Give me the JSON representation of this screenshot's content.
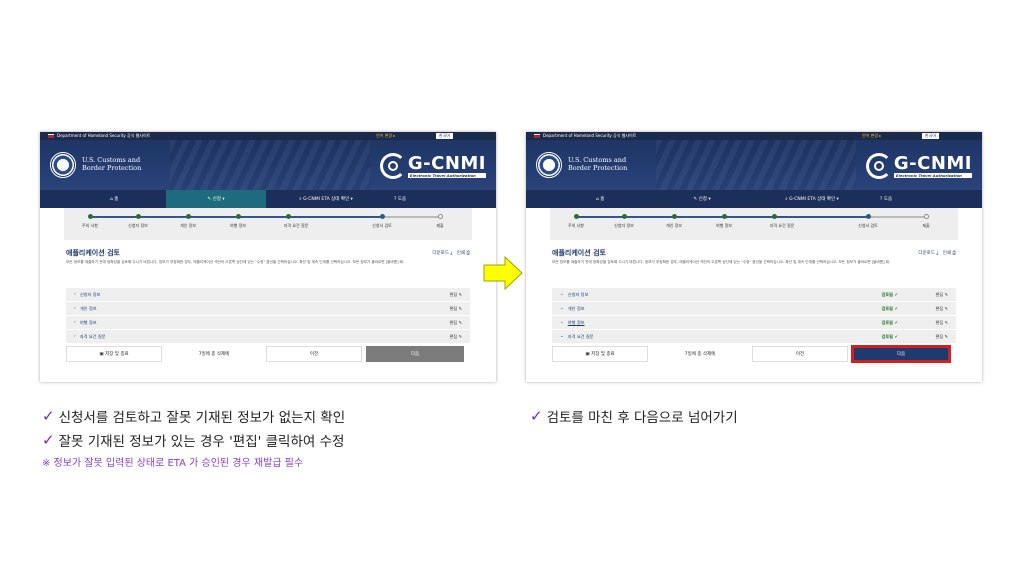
{
  "colors": {
    "accent_check": "#6a2fc1",
    "note_purple": "#8a3fd1",
    "header_navy": "#1f3565",
    "highlight_red": "#d61e1e"
  },
  "left": {
    "gov_banner": "Department of Homeland Security 공식 웹사이트",
    "lang_change": "언어 변경 ▸",
    "lang_current": "한국어",
    "agency_line1": "U.S. Customs and",
    "agency_line2": "Border Protection",
    "logo_text": "G-CNMI",
    "logo_sub": "Electronic Travel Authorization",
    "nav": {
      "home": "홈",
      "apply": "신청 ▾",
      "status": "G-CNMI ETA 상태 확인 ▾",
      "help": "도움"
    },
    "steps": [
      "주의 사항",
      "신청자 정보",
      "개인 정보",
      "여행 정보",
      "자격 요건 질문",
      "신청서 검토",
      "제출"
    ],
    "review_title": "애플리케이션 검토",
    "download": "다운로드",
    "print": "인쇄",
    "desc": "모든 정보를 제출하기 전에 정확성을 검토해 주시기 바랍니다. 정보가 부정확한 경우, 애플리케이션 섹션의 오른쪽 상단에 있는 \"수정\" 옵션을 선택하십시오. 확인 및 계속 단계를 선택하십시오. 모든 정보가 올바르면 [올바름] 때.",
    "sections": [
      "신청자 정보",
      "개인 정보",
      "여행 정보",
      "자격 요건 질문"
    ],
    "edit_label": "편집",
    "save_exit": "저장 및 종료",
    "days_left": "7일에 종 삭제에",
    "prev": "이전",
    "next": "다음"
  },
  "right": {
    "gov_banner": "Department of Homeland Security 공식 웹사이트",
    "lang_change": "언어 변경 ▸",
    "lang_current": "한국어",
    "agency_line1": "U.S. Customs and",
    "agency_line2": "Border Protection",
    "logo_text": "G-CNMI",
    "logo_sub": "Electronic Travel Authorization",
    "nav": {
      "home": "홈",
      "apply": "신청 ▾",
      "status": "G-CNMI ETA 상태 확인 ▾",
      "help": "도움"
    },
    "steps": [
      "주의 사항",
      "신청자 정보",
      "개인 정보",
      "여행 정보",
      "자격 요건 질문",
      "신청서 검토",
      "제출"
    ],
    "review_title": "애플리케이션 검토",
    "download": "다운로드",
    "print": "인쇄",
    "desc": "모든 정보를 제출하기 전에 정확성을 검토해 주시기 바랍니다. 정보가 부정확한 경우, 애플리케이션 섹션의 오른쪽 상단에 있는 \"수정\" 옵션을 선택하십시오. 확인 및 계속 단계를 선택하십시오. 모든 정보가 올바르면 [올바름] 때.",
    "sections": [
      "신청자 정보",
      "개인 정보",
      "여행 정보",
      "자격 요건 질문"
    ],
    "reviewed_label": "검토됨",
    "edit_label": "편집",
    "save_exit": "저장 및 종료",
    "days_left": "7일에 종 삭제에",
    "prev": "이전",
    "next": "다음"
  },
  "notes": {
    "left_line1": "신청서를 검토하고 잘못 기재된 정보가 없는지 확인",
    "left_line2": "잘못 기재된 정보가 있는 경우 '편집' 클릭하여 수정",
    "left_warning": "※ 정보가 잘못 입력된 상태로 ETA 가 승인된 경우 재발급 필수",
    "right_line1": "검토를 마친 후 다음으로 넘어가기"
  }
}
